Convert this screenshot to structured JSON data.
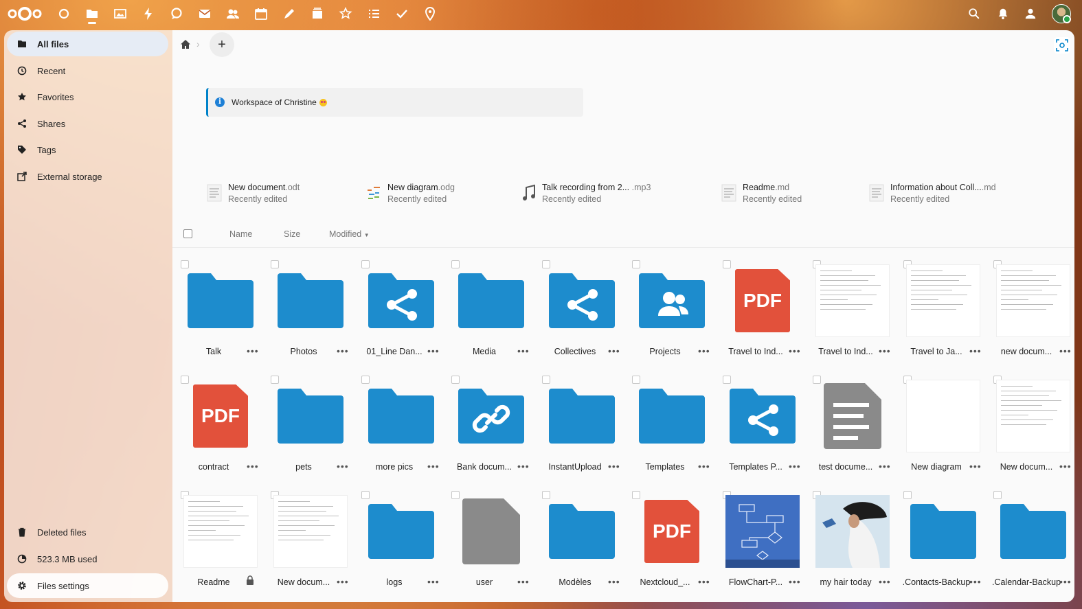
{
  "colors": {
    "accent": "#0082c9",
    "folder": "#1d8ccd",
    "pdf": "#e2513b",
    "sidebar_active": "#e6ecf5"
  },
  "topbar": {
    "apps": [
      "dashboard-icon",
      "files-icon",
      "photos-icon",
      "activity-icon",
      "talk-icon",
      "mail-icon",
      "contacts-icon",
      "calendar-icon",
      "notes-icon",
      "deck-icon",
      "integrations-icon",
      "tasks-icon",
      "checklist-icon",
      "maps-icon"
    ],
    "right": [
      "search-icon",
      "notifications-icon",
      "contacts-menu-icon"
    ]
  },
  "sidebar": {
    "items": [
      {
        "label": "All files",
        "icon": "folder-icon"
      },
      {
        "label": "Recent",
        "icon": "clock-icon"
      },
      {
        "label": "Favorites",
        "icon": "star-icon"
      },
      {
        "label": "Shares",
        "icon": "share-icon"
      },
      {
        "label": "Tags",
        "icon": "tag-icon"
      },
      {
        "label": "External storage",
        "icon": "external-icon"
      }
    ],
    "footer": {
      "deleted": "Deleted files",
      "quota": "523.3 MB used",
      "settings": "Files settings"
    }
  },
  "main": {
    "notice": "Workspace of Christine",
    "recent": [
      {
        "name": "New document",
        "ext": ".odt",
        "status": "Recently edited"
      },
      {
        "name": "New diagram",
        "ext": ".odg",
        "status": "Recently edited"
      },
      {
        "name": "Talk recording from 2...",
        "ext": " .mp3",
        "status": "Recently edited"
      },
      {
        "name": "Readme",
        "ext": ".md",
        "status": "Recently edited"
      },
      {
        "name": "Information about Coll...",
        "ext": ".md",
        "status": "Recently edited"
      }
    ],
    "columns": {
      "name": "Name",
      "size": "Size",
      "modified": "Modified"
    },
    "menu_dots": "•••",
    "files": [
      {
        "name": "Talk",
        "type": "folder"
      },
      {
        "name": "Photos",
        "type": "folder"
      },
      {
        "name": "01_Line Dan...",
        "type": "folder-shared"
      },
      {
        "name": "Media",
        "type": "folder"
      },
      {
        "name": "Collectives",
        "type": "folder-shared"
      },
      {
        "name": "Projects",
        "type": "folder-group"
      },
      {
        "name": "Travel to Ind...",
        "type": "pdf",
        "badge": "PDF"
      },
      {
        "name": "Travel to Ind...",
        "type": "doc"
      },
      {
        "name": "Travel to Ja...",
        "type": "doc"
      },
      {
        "name": "new docum...",
        "type": "doc"
      },
      {
        "name": "contract",
        "type": "pdf",
        "badge": "PDF"
      },
      {
        "name": "pets",
        "type": "folder"
      },
      {
        "name": "more pics",
        "type": "folder"
      },
      {
        "name": "Bank docum...",
        "type": "folder-link"
      },
      {
        "name": "InstantUpload",
        "type": "folder"
      },
      {
        "name": "Templates",
        "type": "folder"
      },
      {
        "name": "Templates P...",
        "type": "folder-shared"
      },
      {
        "name": "test docume...",
        "type": "text"
      },
      {
        "name": "New diagram",
        "type": "blank"
      },
      {
        "name": "New docum...",
        "type": "doc"
      },
      {
        "name": "Readme",
        "type": "doc",
        "locked": true
      },
      {
        "name": "New docum...",
        "type": "doc"
      },
      {
        "name": "logs",
        "type": "folder"
      },
      {
        "name": "user",
        "type": "file-gray"
      },
      {
        "name": "Modèles",
        "type": "folder"
      },
      {
        "name": "Nextcloud_...",
        "type": "pdf",
        "badge": "PDF"
      },
      {
        "name": "FlowChart-P...",
        "type": "image-flow"
      },
      {
        "name": "my hair today",
        "type": "image-photo"
      },
      {
        "name": ".Contacts-Backup",
        "type": "folder"
      },
      {
        "name": ".Calendar-Backup",
        "type": "folder"
      }
    ]
  }
}
